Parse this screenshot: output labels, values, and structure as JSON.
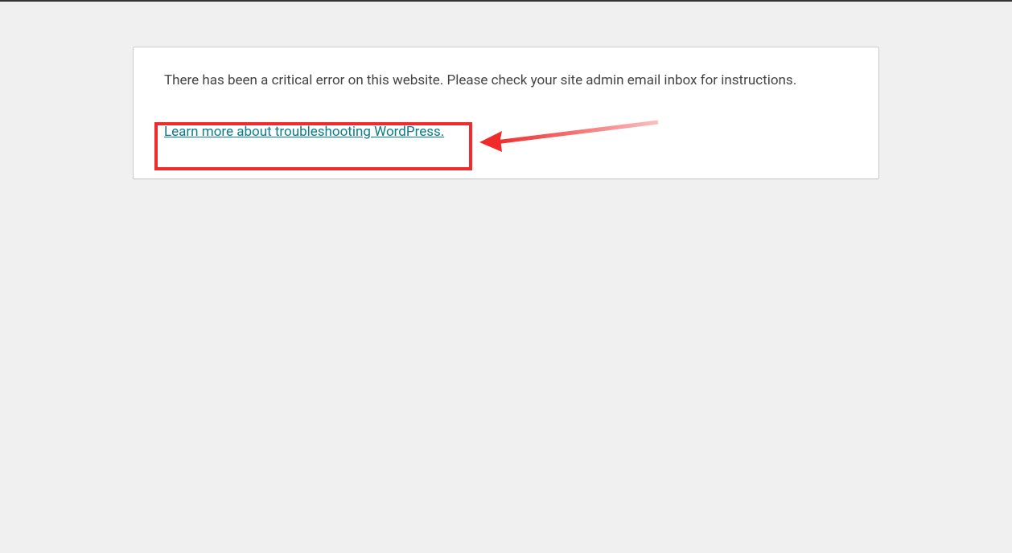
{
  "error": {
    "message": "There has been a critical error on this website. Please check your site admin email inbox for instructions.",
    "link_text": "Learn more about troubleshooting WordPress."
  }
}
